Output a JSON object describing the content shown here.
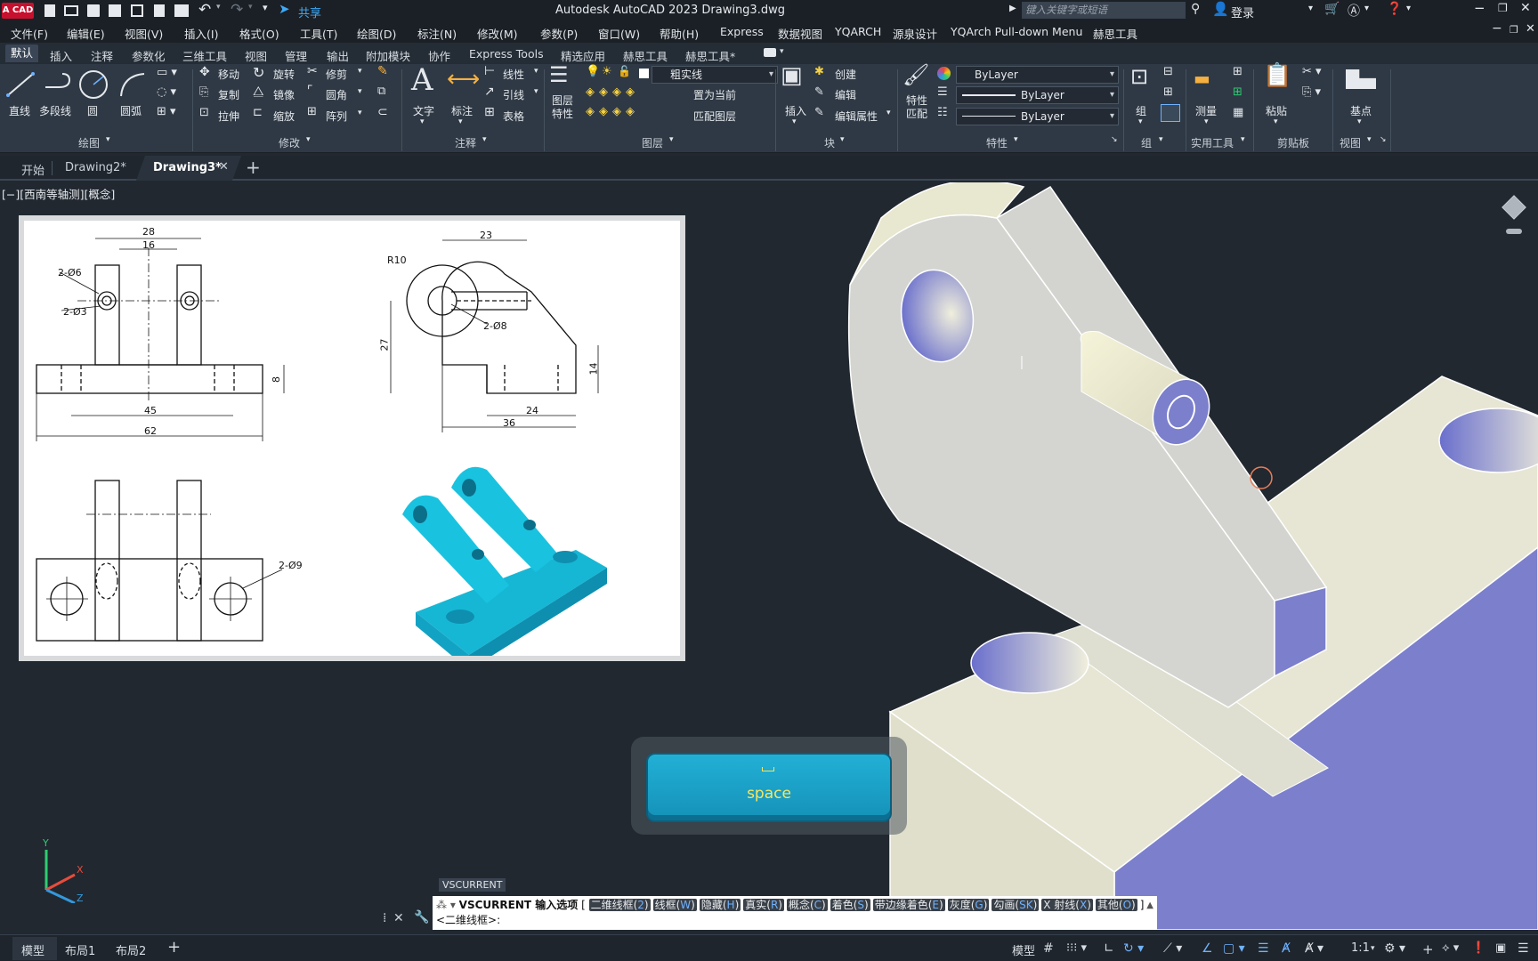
{
  "titlebar": {
    "logo": "A CAD",
    "share": "共享",
    "title": "Autodesk AutoCAD 2023    Drawing3.dwg",
    "search_placeholder": "键入关键字或短语",
    "login": "登录"
  },
  "menu": [
    "文件(F)",
    "编辑(E)",
    "视图(V)",
    "插入(I)",
    "格式(O)",
    "工具(T)",
    "绘图(D)",
    "标注(N)",
    "修改(M)",
    "参数(P)",
    "窗口(W)",
    "帮助(H)",
    "Express",
    "数据视图",
    "YQARCH",
    "源泉设计",
    "YQArch Pull-down Menu",
    "赫思工具"
  ],
  "ribbon_tabs": [
    "默认",
    "插入",
    "注释",
    "参数化",
    "三维工具",
    "视图",
    "管理",
    "输出",
    "附加模块",
    "协作",
    "Express Tools",
    "精选应用",
    "赫思工具",
    "赫思工具*"
  ],
  "ribbon": {
    "draw": {
      "line": "直线",
      "polyline": "多段线",
      "circle": "圆",
      "arc": "圆弧",
      "title": "绘图"
    },
    "modify": {
      "move": "移动",
      "rotate": "旋转",
      "trim": "修剪",
      "copy": "复制",
      "mirror": "镜像",
      "fillet": "圆角",
      "stretch": "拉伸",
      "scale": "缩放",
      "array": "阵列",
      "title": "修改"
    },
    "annotation": {
      "text": "文字",
      "dim": "标注",
      "linetype": "线性",
      "leader": "引线",
      "table": "表格",
      "title": "注释"
    },
    "layers": {
      "props": "图层\n特性",
      "layer_name": "粗实线",
      "make_current": "置为当前",
      "match": "匹配图层",
      "title": "图层"
    },
    "block": {
      "insert": "插入",
      "create": "创建",
      "edit": "编辑",
      "edit_attr": "编辑属性",
      "title": "块"
    },
    "properties": {
      "match": "特性\n匹配",
      "color": "ByLayer",
      "linetype": "ByLayer",
      "lineweight": "ByLayer",
      "title": "特性"
    },
    "group": {
      "label": "组",
      "title": "组"
    },
    "utilities": {
      "measure": "测量",
      "title": "实用工具"
    },
    "clipboard": {
      "paste": "粘贴",
      "title": "剪贴板"
    },
    "view": {
      "base": "基点",
      "title": "视图"
    }
  },
  "doc_tabs": [
    "开始",
    "Drawing2*",
    "Drawing3*"
  ],
  "viewport_label": "[−][西南等轴测][概念]",
  "drawing": {
    "dims": [
      "28",
      "16",
      "2-Ø6",
      "2-Ø3",
      "8",
      "45",
      "62",
      "23",
      "R10",
      "2-Ø8",
      "27",
      "14",
      "24",
      "36",
      "2-Ø9"
    ]
  },
  "key_overlay": "space",
  "command": {
    "tooltip": "VSCURRENT",
    "prompt": "VSCURRENT 输入选项",
    "options": [
      {
        "name": "二维线框(",
        "key": "2",
        "end": ")"
      },
      {
        "name": "线框(",
        "key": "W",
        "end": ")"
      },
      {
        "name": "隐藏(",
        "key": "H",
        "end": ")"
      },
      {
        "name": "真实(",
        "key": "R",
        "end": ")"
      },
      {
        "name": "概念(",
        "key": "C",
        "end": ")"
      },
      {
        "name": "着色(",
        "key": "S",
        "end": ")"
      },
      {
        "name": "带边缘着色(",
        "key": "E",
        "end": ")"
      },
      {
        "name": "灰度(",
        "key": "G",
        "end": ")"
      },
      {
        "name": "勾画(",
        "key": "SK",
        "end": ")"
      },
      {
        "name": "X 射线(",
        "key": "X",
        "end": ")"
      },
      {
        "name": "其他(",
        "key": "O",
        "end": ")"
      }
    ],
    "default": "<二维线框>:"
  },
  "layout_tabs": [
    "模型",
    "布局1",
    "布局2"
  ],
  "status": {
    "model": "模型",
    "scale": "1:1"
  },
  "colors": {
    "accent_blue": "#7a7fd0",
    "cream": "#e9e8d6",
    "cyan_model": "#19c3e0"
  }
}
